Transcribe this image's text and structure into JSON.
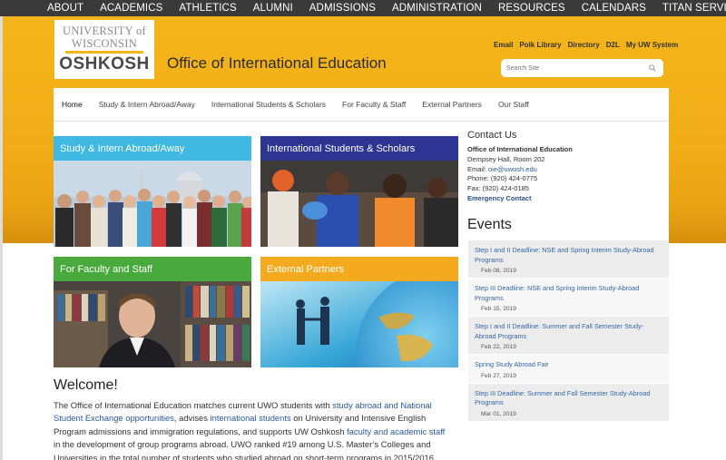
{
  "topnav": {
    "items": [
      "ABOUT",
      "ACADEMICS",
      "ATHLETICS",
      "ALUMNI",
      "ADMISSIONS",
      "ADMINISTRATION",
      "RESOURCES",
      "CALENDARS",
      "TITAN SERVICES"
    ]
  },
  "logo": {
    "line1": "UNIVERSITY of",
    "line2": "WISCONSIN",
    "line3": "OSHKOSH"
  },
  "office_title": "Office of International Education",
  "util_links": [
    "Email",
    "Polk Library",
    "Directory",
    "D2L",
    "My UW System"
  ],
  "search": {
    "placeholder": "Search Site"
  },
  "secnav": [
    "Home",
    "Study & Intern Abroad/Away",
    "International Students & Scholars",
    "For Faculty & Staff",
    "External Partners",
    "Our Staff"
  ],
  "tiles": [
    {
      "label": "Study & Intern Abroad/Away",
      "color": "#3fb8e4"
    },
    {
      "label": "International Students & Scholars",
      "color": "#2d3592"
    },
    {
      "label": "For Faculty and Staff",
      "color": "#48a93c"
    },
    {
      "label": "External Partners",
      "color": "#f5a91d"
    }
  ],
  "contact": {
    "heading": "Contact Us",
    "office": "Office of International Education",
    "address": "Dempsey Hall, Room 202",
    "email_label": "Email: ",
    "email": "oie@uwosh.edu",
    "phone": "Phone: (920) 424-0775",
    "fax": "Fax: (920) 424-0185",
    "emergency": "Emergency Contact"
  },
  "events": {
    "heading": "Events",
    "items": [
      {
        "title": "Step I and II Deadline: NSE and Spring Interim Study-Abroad Programs",
        "date": "Feb 08, 2019"
      },
      {
        "title": "Step III Deadline: NSE and Spring Interim Study-Abroad Programs",
        "date": "Feb 15, 2019"
      },
      {
        "title": "Step I and II Deadline: Summer and Fall Semester Study-Abroad Programs",
        "date": "Feb 22, 2019"
      },
      {
        "title": "Spring Study Abroad Fair",
        "date": "Feb 27, 2019"
      },
      {
        "title": "Step III Deadline: Summer and Fall Semester Study-Abroad Programs",
        "date": "Mar 01, 2019"
      }
    ]
  },
  "welcome": {
    "heading": "Welcome!",
    "p1": "The Office of International Education matches current UWO students with ",
    "link1": "study abroad and National Student Exchange opportunities",
    "p2": ", advises ",
    "link2": "international students",
    "p3": " on University and Intensive English Program admissions and immigration regulations, and supports UW Oshkosh ",
    "link3": "faculty and academic staff",
    "p4": " in the development of group programs abroad.  UWO ranked #19 among U.S. Master’s Colleges and Universities in the total number of students who studied abroad on short-term programs in 2015/2016."
  }
}
